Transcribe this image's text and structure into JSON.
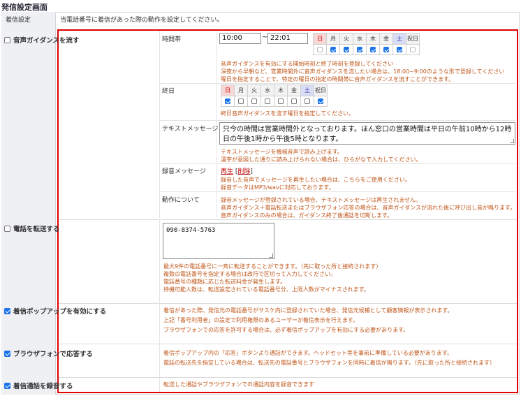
{
  "page_title": "発信設定画面",
  "section_label": "着信設定",
  "section_desc": "当電話番号に着信があった際の動作を設定してください。",
  "guidance": {
    "label": "音声ガイダンスを流す",
    "checked": false,
    "time_band": {
      "label": "時間帯",
      "start": "10:00",
      "end": "22:01",
      "separator": "~",
      "days": [
        "日",
        "月",
        "火",
        "水",
        "木",
        "金",
        "土",
        "祝日"
      ],
      "checked": [
        false,
        true,
        true,
        true,
        true,
        true,
        true,
        false
      ],
      "notes": [
        "音声ガイダンスを有効にする開始時刻と終了時刻を登録してください",
        "深夜から早朝など、営業時間外に音声ガイダンスを流したい場合は、18:00~9:00のような形で登録してください",
        "曜日を指定することで、特定の曜日の指定の時間帯に音声ガイダンスを流すことができます。"
      ]
    },
    "all_day": {
      "label": "終日",
      "days": [
        "日",
        "月",
        "火",
        "水",
        "木",
        "金",
        "土",
        "祝日"
      ],
      "checked": [
        true,
        false,
        false,
        false,
        false,
        false,
        false,
        true
      ],
      "note": "終日音声ガイダンスを流す曜日を指定してください。"
    },
    "text_message": {
      "label": "テキストメッセージ",
      "value": "只今の時間は営業時間外となっております。ほん窓口の営業時間は平日の午前10時から12時、平日の午後1時から午後5時となります。",
      "line1": "只今の時間は営業時間外となっております。ほん窓口の営業時間は平日の午前10時から12時、平",
      "line2": "日の午後1時から午後5時となります。",
      "notes": [
        "テキストメッセージを機械音声で読み上げます。",
        "漢字が意図した通りに読み上げられない場合は、ひらがなで入力してください。"
      ]
    },
    "recorded": {
      "label": "録音メッセージ",
      "play": "再生",
      "delete": "削除",
      "bracket_open": "[",
      "bracket_close": "]",
      "notes": [
        "録音した音声でメッセージを再生したい場合は、こちらをご使用ください。",
        "録音データはMP3/wavに対応しております。"
      ]
    },
    "behavior": {
      "label": "動作について",
      "notes": [
        "録音メッセージが登録されている場合、テキストメッセージは再生されません。",
        "音声ガイダンス＋電話転送またはブラウザフォン応答の場合は、音声ガイダンスが流れた後に呼び出し音が鳴ります。",
        "音声ガイダンスのみの場合は、ガイダンス終了後通話を切断します。"
      ]
    }
  },
  "forward": {
    "label": "電話を転送する",
    "checked": false,
    "value": "090-8374-5763",
    "notes": [
      "最大9件の電話番号に一斉に転送することができます。（先に取った所と接続されます）",
      "複数の電話番号を指定する場合は改行で区切って入力してください。",
      "電話番号の種類に応じた転送料金が発生します。",
      "待機可能人数は、転送設定されている電話番号分、上限人数がマイナスされます。"
    ]
  },
  "popup": {
    "label": "着信ポップアップを有効にする",
    "checked": true,
    "notes": [
      "着信があった際、発信元の電話番号がサスケ内に登録されていた場合、発信元候補として顧客情報が表示されます。",
      "上記「番号利用者」の設定で利用権限のあるユーザーが着信表示を行えます。",
      "ブラウザフォンでの応答を許可する場合は、必ず着信ポップアップを有効にする必要があります。"
    ]
  },
  "browser_phone": {
    "label": "ブラウザフォンで応答する",
    "checked": true,
    "notes": [
      "着信ポップアップ内の「応答」ボタンより通話ができます。ヘッドセット等を事前に準備している必要があります。",
      "電話の転送先を指定している場合は、転送先の電話番号とブラウザフォンを同時に着信が鳴ります。（先に取った所と接続されます）"
    ]
  },
  "record_call": {
    "label": "着信通話を録音する",
    "checked": true,
    "note": "転送した通話やブラウザフォンでの通話内容を録音できます"
  },
  "colors": {
    "accent_red": "#e00000",
    "note_orange": "#c0561a",
    "checkbox_blue": "#1a73e8"
  }
}
